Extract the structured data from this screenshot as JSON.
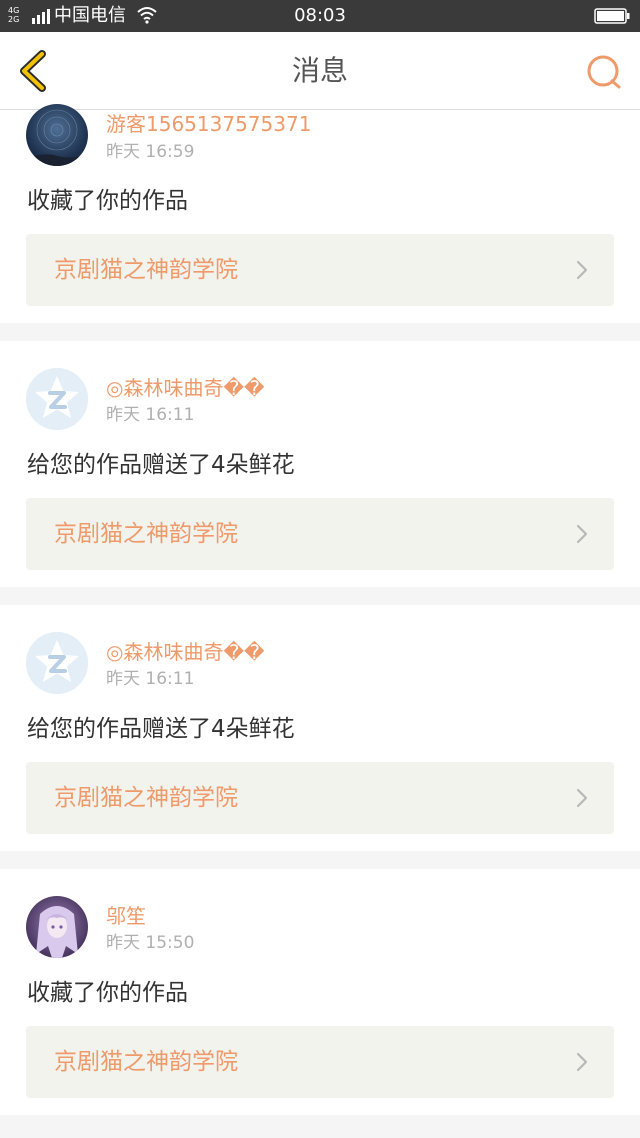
{
  "status_bar": {
    "network_top": "4G",
    "network_bottom": "2G",
    "carrier": "中国电信",
    "time": "08:03"
  },
  "nav": {
    "title": "消息"
  },
  "colors": {
    "accent": "#ee9a6a",
    "back_icon": "#f2c200"
  },
  "messages": [
    {
      "user": "游客1565137575371",
      "time": "昨天 16:59",
      "action": "收藏了你的作品",
      "work": "京剧猫之神韵学院",
      "avatar": "starry-night-avatar"
    },
    {
      "user": "◎森林味曲奇��",
      "time": "昨天 16:11",
      "action": "给您的作品赠送了4朵鲜花",
      "work": "京剧猫之神韵学院",
      "avatar": "qq-default-avatar"
    },
    {
      "user": "◎森林味曲奇��",
      "time": "昨天 16:11",
      "action": "给您的作品赠送了4朵鲜花",
      "work": "京剧猫之神韵学院",
      "avatar": "qq-default-avatar"
    },
    {
      "user": "邬笙",
      "time": "昨天 15:50",
      "action": "收藏了你的作品",
      "work": "京剧猫之神韵学院",
      "avatar": "anime-girl-avatar"
    }
  ]
}
